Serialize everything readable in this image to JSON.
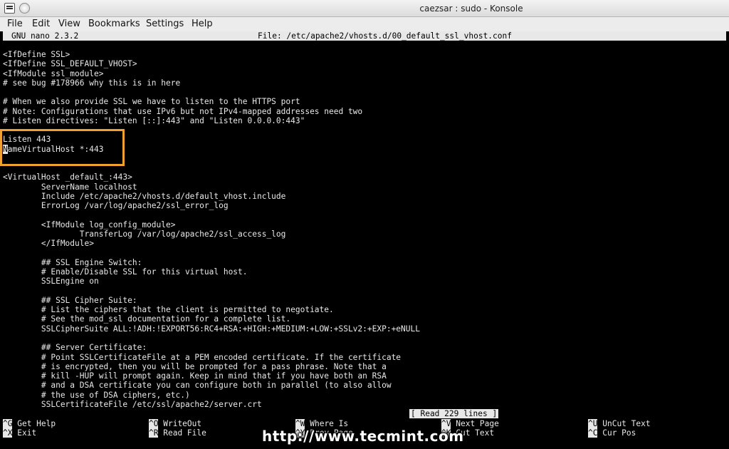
{
  "window": {
    "title": "caezsar : sudo - Konsole"
  },
  "menubar": [
    "File",
    "Edit",
    "View",
    "Bookmarks",
    "Settings",
    "Help"
  ],
  "nano": {
    "version": "GNU nano 2.3.2",
    "file": "File: /etc/apache2/vhosts.d/00_default_ssl_vhost.conf",
    "status": "[ Read 229 lines ]"
  },
  "lines": [
    "<IfDefine SSL>",
    "<IfDefine SSL_DEFAULT_VHOST>",
    "<IfModule ssl_module>",
    "# see bug #178966 why this is in here",
    "",
    "# When we also provide SSL we have to listen to the HTTPS port",
    "# Note: Configurations that use IPv6 but not IPv4-mapped addresses need two",
    "# Listen directives: \"Listen [::]:443\" and \"Listen 0.0.0.0:443\"",
    "",
    "Listen 443",
    "NameVirtualHost *:443",
    "",
    "",
    "<VirtualHost _default_:443>",
    "        ServerName localhost",
    "        Include /etc/apache2/vhosts.d/default_vhost.include",
    "        ErrorLog /var/log/apache2/ssl_error_log",
    "",
    "        <IfModule log_config_module>",
    "                TransferLog /var/log/apache2/ssl_access_log",
    "        </IfModule>",
    "",
    "        ## SSL Engine Switch:",
    "        # Enable/Disable SSL for this virtual host.",
    "        SSLEngine on",
    "",
    "        ## SSL Cipher Suite:",
    "        # List the ciphers that the client is permitted to negotiate.",
    "        # See the mod_ssl documentation for a complete list.",
    "        SSLCipherSuite ALL:!ADH:!EXPORT56:RC4+RSA:+HIGH:+MEDIUM:+LOW:+SSLv2:+EXP:+eNULL",
    "",
    "        ## Server Certificate:",
    "        # Point SSLCertificateFile at a PEM encoded certificate. If the certificate",
    "        # is encrypted, then you will be prompted for a pass phrase. Note that a",
    "        # kill -HUP will prompt again. Keep in mind that if you have both an RSA",
    "        # and a DSA certificate you can configure both in parallel (to also allow",
    "        # the use of DSA ciphers, etc.)",
    "        SSLCertificateFile /etc/ssl/apache2/server.crt"
  ],
  "cursor_line": {
    "cursor_char": "N",
    "rest": "ameVirtualHost *:443"
  },
  "shortcuts": [
    {
      "key": "^G",
      "label": "Get Help"
    },
    {
      "key": "^O",
      "label": "WriteOut"
    },
    {
      "key": "^W",
      "label": "Where Is"
    },
    {
      "key": "^V",
      "label": "Next Page"
    },
    {
      "key": "^U",
      "label": "UnCut Text"
    },
    {
      "key": "^X",
      "label": "Exit"
    },
    {
      "key": "^R",
      "label": "Read File"
    },
    {
      "key": "^Y",
      "label": "Prev Page"
    },
    {
      "key": "^K",
      "label": "Cut Text"
    },
    {
      "key": "^C",
      "label": "Cur Pos"
    }
  ],
  "watermark": "http://www.tecmint.com",
  "colors": {
    "terminal_bg": "#000000",
    "terminal_fg": "#e8e8e8",
    "highlight_box": "#f0a030"
  }
}
